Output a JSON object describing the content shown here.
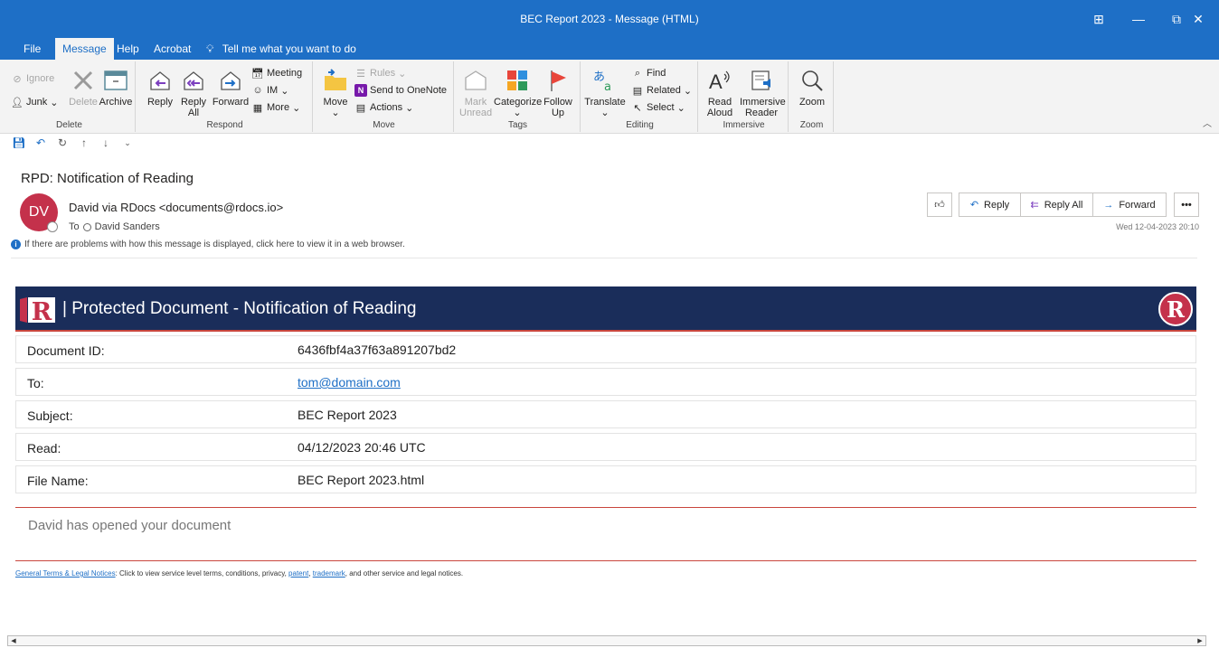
{
  "window": {
    "title": "BEC Report 2023 - Message (HTML)",
    "controls": [
      "⊞",
      "—",
      "⧉",
      "✕"
    ]
  },
  "tabs": [
    "File",
    "Message",
    "Help",
    "Acrobat"
  ],
  "active_tab": "Message",
  "tell_me": "Tell me what you want to do",
  "ribbon": {
    "delete": {
      "label": "Delete",
      "ignore": "Ignore",
      "junk": "Junk",
      "delete_btn": "Delete",
      "archive": "Archive"
    },
    "respond": {
      "label": "Respond",
      "reply": "Reply",
      "reply_all": "Reply All",
      "forward": "Forward",
      "meeting": "Meeting",
      "im": "IM",
      "more": "More"
    },
    "move": {
      "label": "Move",
      "move_btn": "Move",
      "rules": "Rules",
      "onenote": "Send to OneNote",
      "actions": "Actions"
    },
    "tags": {
      "label": "Tags",
      "mark_unread": "Mark Unread",
      "categorize": "Categorize",
      "follow_up": "Follow Up"
    },
    "editing": {
      "label": "Editing",
      "translate": "Translate",
      "find": "Find",
      "related": "Related",
      "select": "Select"
    },
    "immersive": {
      "label": "Immersive",
      "read_aloud": "Read Aloud",
      "immersive_reader": "Immersive Reader"
    },
    "zoom": {
      "label": "Zoom",
      "zoom_btn": "Zoom"
    }
  },
  "message": {
    "subject": "RPD: Notification of Reading",
    "avatar_initials": "DV",
    "from": "David via RDocs <documents@rdocs.io>",
    "to_label": "To",
    "to_name": "David Sanders",
    "info": "If there are problems with how this message is displayed, click here to view it in a web browser.",
    "actions": {
      "reply": "Reply",
      "reply_all": "Reply All",
      "forward": "Forward",
      "more": "•••"
    },
    "date": "Wed 12-04-2023 20:10"
  },
  "body": {
    "banner_title": "| Protected Document - Notification of Reading",
    "logo_letter": "R",
    "rows": [
      {
        "key": "Document ID:",
        "value": "6436fbf4a37f63a891207bd2"
      },
      {
        "key": "To:",
        "value": "tom@domain.com"
      },
      {
        "key": "Subject:",
        "value": "BEC Report 2023"
      },
      {
        "key": "Read:",
        "value": "04/12/2023 20:46 UTC"
      },
      {
        "key": "File Name:",
        "value": "BEC Report 2023.html"
      }
    ],
    "opened_text": "David has opened your document",
    "footer": {
      "terms_link": "General Terms & Legal Notices",
      "text1": ": Click to view service level terms, conditions, privacy, ",
      "patent": "patent",
      "comma": ", ",
      "trademark": "trademark",
      "text2": ", and other service and legal notices."
    }
  },
  "colors": {
    "accent": "#1e6fc6",
    "banner": "#1a2d5a",
    "brand_red": "#c4314b"
  }
}
